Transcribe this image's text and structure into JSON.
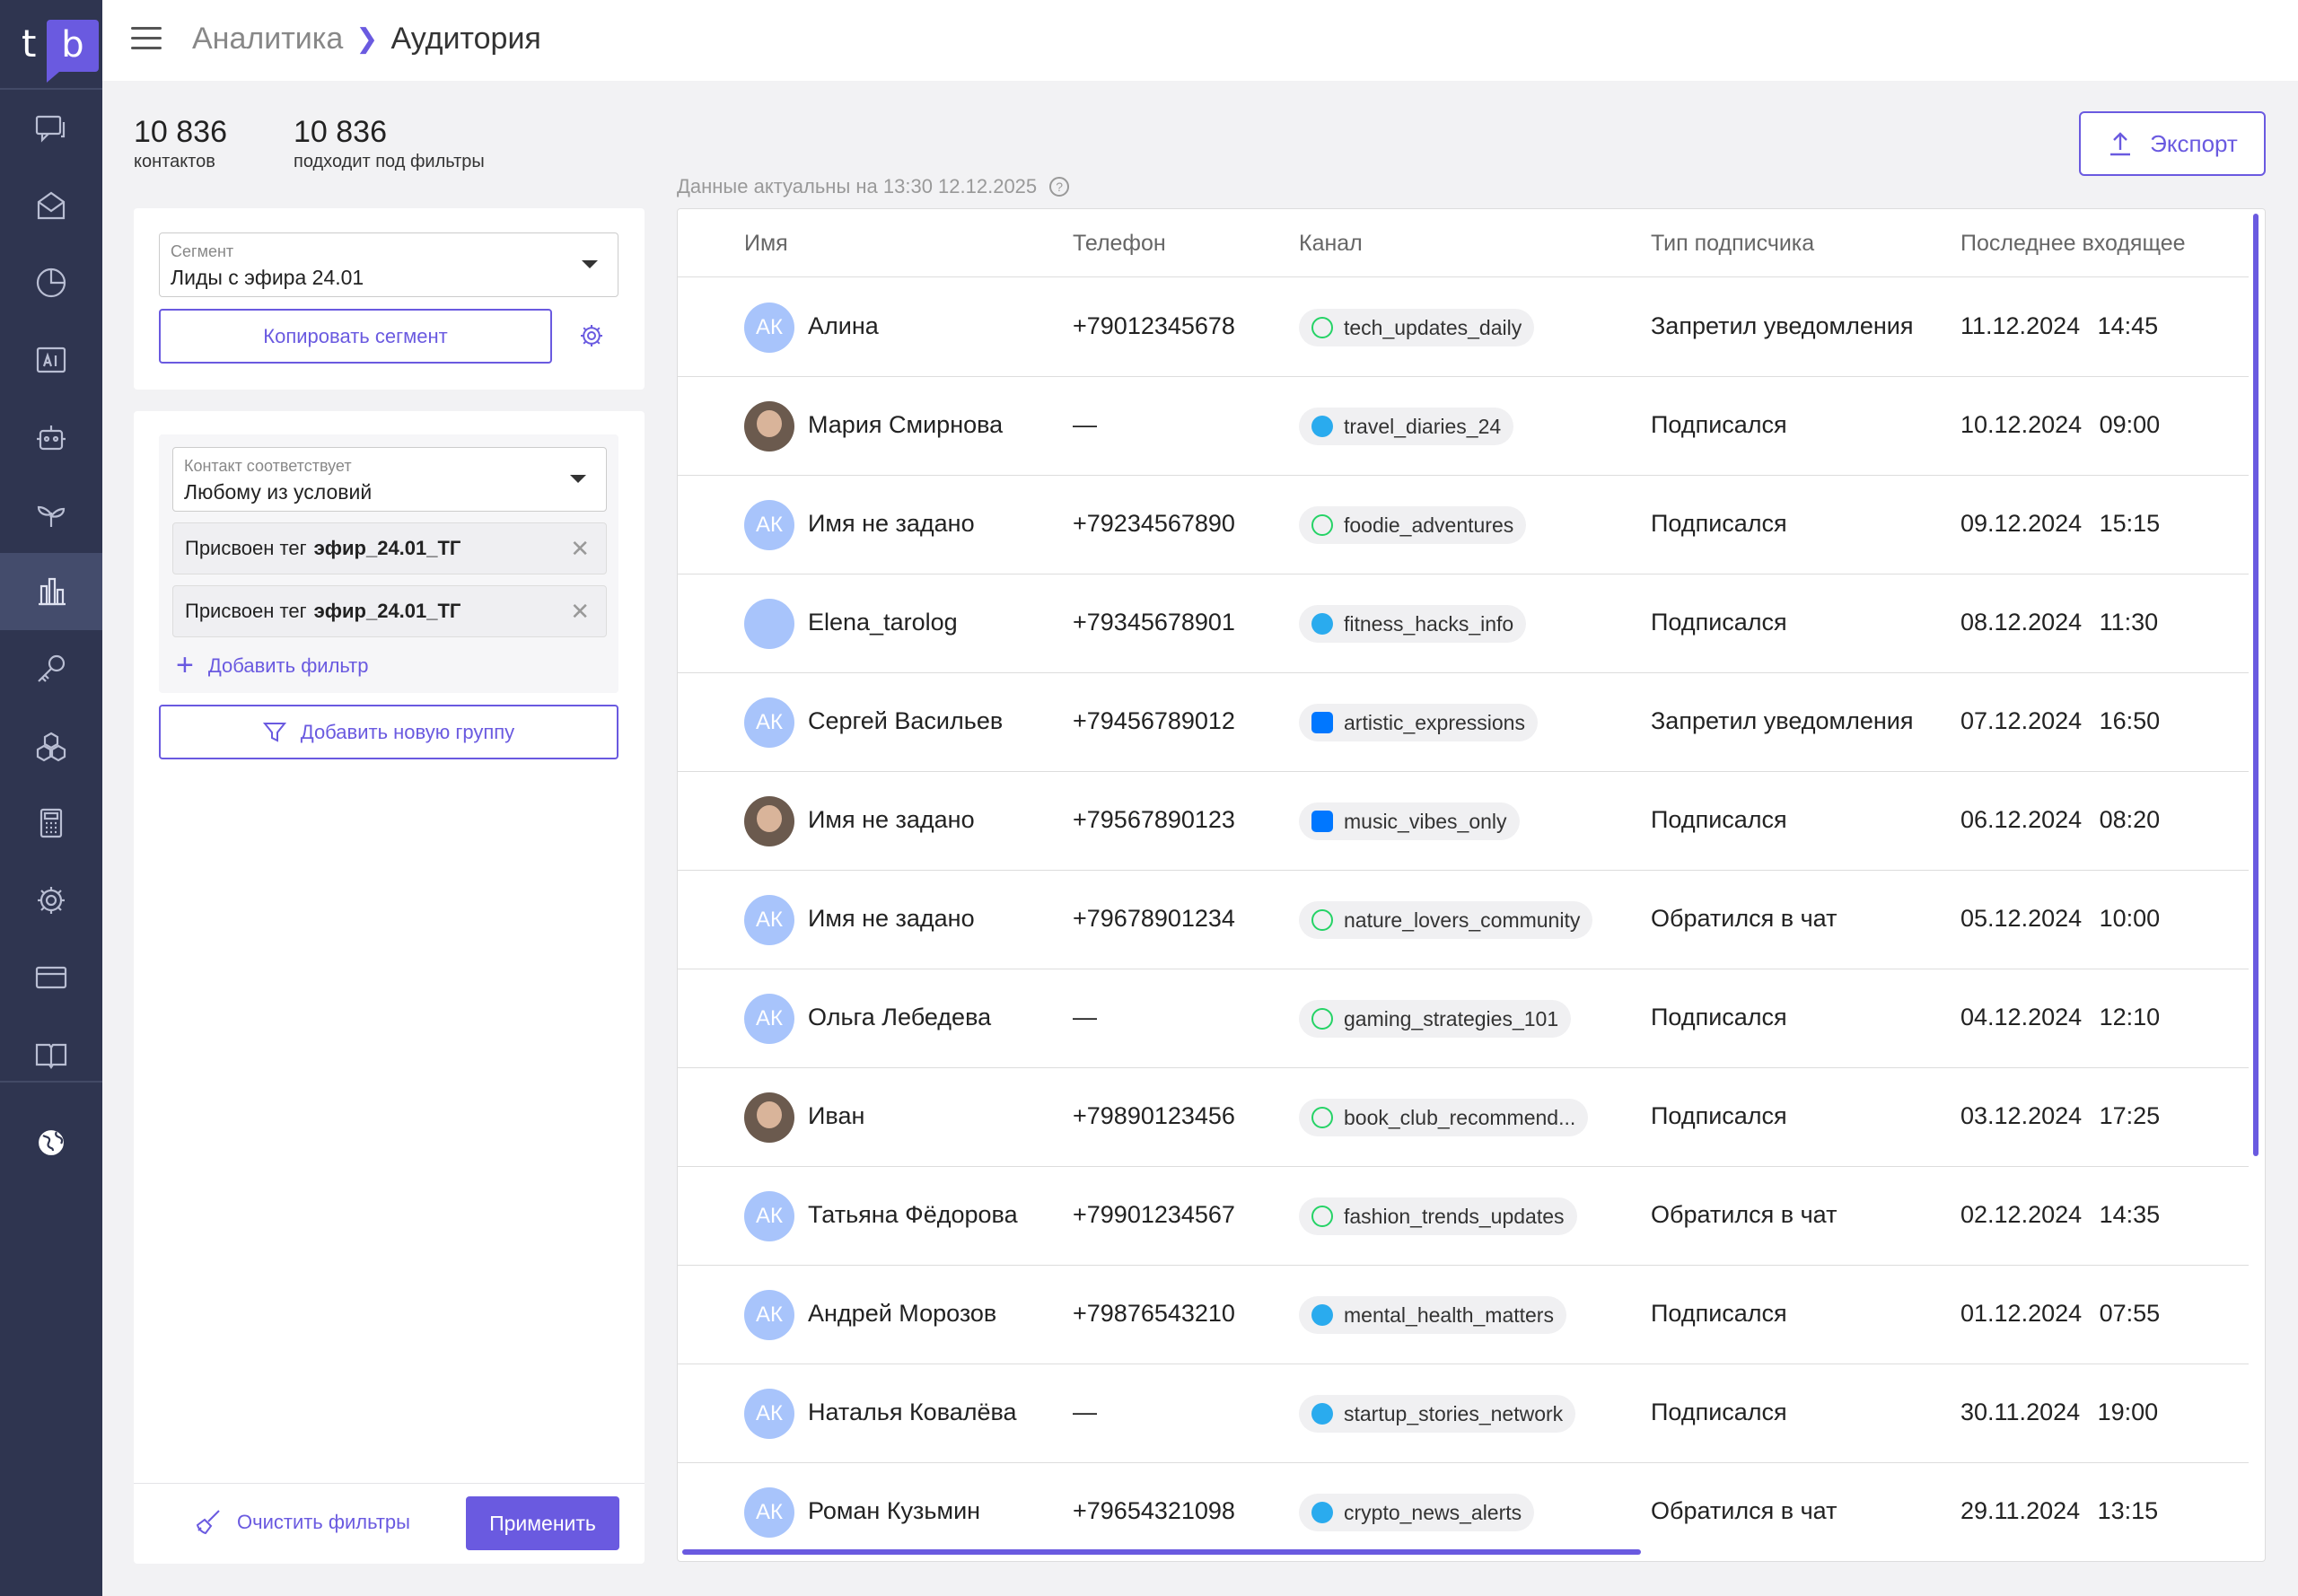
{
  "logo": {
    "t": "t",
    "b": "b"
  },
  "breadcrumb": {
    "parent": "Аналитика",
    "current": "Аудитория"
  },
  "stats": [
    {
      "value": "10 836",
      "label": "контактов"
    },
    {
      "value": "10 836",
      "label": "подходит под фильтры"
    }
  ],
  "segment": {
    "label": "Сегмент",
    "value": "Лиды с эфира 24.01",
    "copy_label": "Копировать сегмент"
  },
  "filters": {
    "match_label": "Контакт соответствует",
    "match_value": "Любому из условий",
    "tags": [
      {
        "prefix": "Присвоен тег",
        "value": "эфир_24.01_ТГ"
      },
      {
        "prefix": "Присвоен тег",
        "value": "эфир_24.01_ТГ"
      }
    ],
    "add_filter": "Добавить фильтр",
    "add_group": "Добавить новую группу",
    "clear": "Очистить фильтры",
    "apply": "Применить"
  },
  "export_label": "Экспорт",
  "actual_text": "Данные актуальны на 13:30 12.12.2025",
  "table": {
    "columns": [
      "Имя",
      "Телефон",
      "Канал",
      "Тип подписчика",
      "Последнее входящее"
    ],
    "rows": [
      {
        "initials": "АК",
        "name": "Алина",
        "phone": "+79012345678",
        "channel": "tech_updates_daily",
        "channel_icon": "whatsapp",
        "type": "Запретил уведомления",
        "date": "11.12.2024 14:45"
      },
      {
        "initials": "",
        "name": "Мария Смирнова",
        "phone": "—",
        "channel": "travel_diaries_24",
        "channel_icon": "telegram",
        "type": "Подписался",
        "date": "10.12.2024 09:00"
      },
      {
        "initials": "АК",
        "name": "Имя не задано",
        "phone": "+79234567890",
        "channel": "foodie_adventures",
        "channel_icon": "whatsapp",
        "type": "Подписался",
        "date": "09.12.2024 15:15"
      },
      {
        "initials": "",
        "name": "Elena_tarolog",
        "phone": "+79345678901",
        "channel": "fitness_hacks_info",
        "channel_icon": "telegram",
        "type": "Подписался",
        "date": "08.12.2024 11:30"
      },
      {
        "initials": "АК",
        "name": "Сергей Васильев",
        "phone": "+79456789012",
        "channel": "artistic_expressions",
        "channel_icon": "vk",
        "type": "Запретил уведомления",
        "date": "07.12.2024 16:50"
      },
      {
        "initials": "",
        "name": "Имя не задано",
        "phone": "+79567890123",
        "channel": "music_vibes_only",
        "channel_icon": "vk",
        "type": "Подписался",
        "date": "06.12.2024 08:20"
      },
      {
        "initials": "АК",
        "name": "Имя не задано",
        "phone": "+79678901234",
        "channel": "nature_lovers_community",
        "channel_icon": "whatsapp",
        "type": "Обратился в чат",
        "date": "05.12.2024 10:00"
      },
      {
        "initials": "АК",
        "name": "Ольга Лебедева",
        "phone": "—",
        "channel": "gaming_strategies_101",
        "channel_icon": "whatsapp",
        "type": "Подписался",
        "date": "04.12.2024 12:10"
      },
      {
        "initials": "",
        "name": "Иван",
        "phone": "+79890123456",
        "channel": "book_club_recommend...",
        "channel_icon": "whatsapp",
        "type": "Подписался",
        "date": "03.12.2024 17:25"
      },
      {
        "initials": "АК",
        "name": "Татьяна Фёдорова",
        "phone": "+79901234567",
        "channel": "fashion_trends_updates",
        "channel_icon": "whatsapp",
        "type": "Обратился в чат",
        "date": "02.12.2024 14:35"
      },
      {
        "initials": "АК",
        "name": "Андрей Морозов",
        "phone": "+79876543210",
        "channel": "mental_health_matters",
        "channel_icon": "telegram",
        "type": "Подписался",
        "date": "01.12.2024 07:55"
      },
      {
        "initials": "АК",
        "name": "Наталья Ковалёва",
        "phone": "—",
        "channel": "startup_stories_network",
        "channel_icon": "telegram",
        "type": "Подписался",
        "date": "30.11.2024 19:00"
      },
      {
        "initials": "АК",
        "name": "Роман Кузьмин",
        "phone": "+79654321098",
        "channel": "crypto_news_alerts",
        "channel_icon": "telegram",
        "type": "Обратился в чат",
        "date": "29.11.2024 13:15"
      }
    ]
  },
  "colors": {
    "accent": "#6a5ae0",
    "sidebar": "#2f3550",
    "avatar": "#a8c4fb"
  }
}
